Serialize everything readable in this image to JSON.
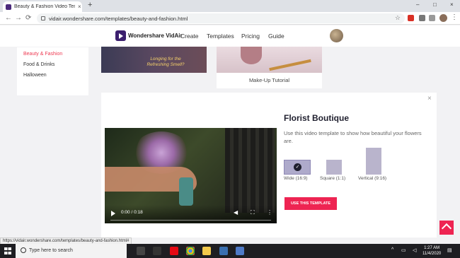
{
  "browser": {
    "tab_title": "Beauty & Fashion Video Templat",
    "tab_close": "×",
    "new_tab": "+",
    "url": "vidair.wondershare.com/templates/beauty-and-fashion.html",
    "status_url": "https://vidair.wondershare.com/templates/beauty-and-fashion.html#",
    "window_controls": [
      "–",
      "□",
      "×"
    ]
  },
  "site": {
    "logo_text": "Wondershare VidAir",
    "nav": [
      "Create",
      "Templates",
      "Pricing",
      "Guide"
    ]
  },
  "sidebar": {
    "items": [
      {
        "label": "Beauty & Fashion",
        "active": true
      },
      {
        "label": "Food & Drinks",
        "active": false
      },
      {
        "label": "Halloween",
        "active": false
      }
    ]
  },
  "cards": {
    "card1_caption": "Longing for the Refreshing Smell?",
    "card2_title": "Make-Up Tutorial"
  },
  "modal": {
    "title": "Florist Boutique",
    "description": "Use this video template to show how beautiful your flowers are.",
    "video_time": "0:00 / 0:18",
    "ratios": [
      {
        "label": "Wide (16:9)",
        "selected": true
      },
      {
        "label": "Square (1:1)",
        "selected": false
      },
      {
        "label": "Vertical (9:16)",
        "selected": false
      }
    ],
    "use_button": "USE THIS TEMPLATE",
    "close": "×"
  },
  "taskbar": {
    "search_placeholder": "Type here to search",
    "time": "1:27 AM",
    "date": "11/4/2020"
  },
  "colors": {
    "accent": "#ee2452",
    "active_category": "#ee3a52",
    "brand": "#3b1f6e"
  }
}
